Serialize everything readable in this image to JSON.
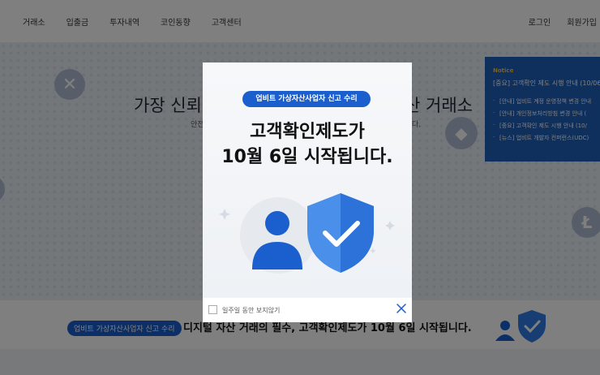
{
  "header": {
    "nav": [
      "거래소",
      "입출금",
      "투자내역",
      "코인동향",
      "고객센터"
    ],
    "login": "로그인",
    "signup": "회원가입"
  },
  "hero": {
    "title_left": "가장 신뢰",
    "title_right": "산 거래소",
    "sub_left": "안전",
    "sub_right": "다."
  },
  "notice": {
    "title": "Notice",
    "first": "[중요] 고객확인 제도 시행 안내 (10/06",
    "items": [
      "[안내] 업비트 계정 운영정책 변경 안내",
      "[안내] 개인정보처리방침 변경 안내 (",
      "[중요] 고객확인 제도 시행 안내 (10/",
      "[뉴스] 업비트 개발자 컨퍼런스(UDC)"
    ]
  },
  "banner": {
    "badge": "업비트 가상자산사업자 신고 수리",
    "text": "디지털 자산 거래의 필수, 고객확인제도가 10월 6일 시작됩니다."
  },
  "popup": {
    "pill": "업비트 가상자산사업자 신고 수리",
    "title_line1": "고객확인제도가",
    "title_line2": "10월 6일 시작됩니다.",
    "dismiss_label": "일주일 동안 보지않기"
  },
  "colors": {
    "accent": "#1b5fce",
    "notice_bg": "#1f5fb9",
    "notice_title": "#f6c14b"
  }
}
